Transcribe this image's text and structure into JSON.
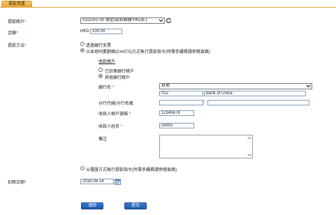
{
  "tabs": {
    "active": "提款資產"
  },
  "form": {
    "account_label": "提款賬戶",
    "account_value": "0111051-00 現金(款款銀額:HKD$-)",
    "amount_label": "金額",
    "amount_currency": "HKD",
    "amount_value": "100.00",
    "method_label": "提款方法",
    "method_options": [
      "透過銀行支票",
      "以本地同業劃帳(CHATS)方式執行提款指令(所需手續費請參閱頁面)",
      "以電匯方式執行提款指令(所需手續費請參閱頁面)"
    ],
    "payee_section_title": "收款帳戶",
    "payee_options": [
      "已註冊銀行賬戶",
      "其他銀行賬戶"
    ],
    "bank_name_label": "銀行名",
    "bank_select_value": "其他",
    "bank_code_value": "012",
    "bank_name_value": "Bank of China",
    "branch_label": "分行代碼/分行名稱",
    "branch_code_value": "",
    "branch_name_value": "",
    "acct_no_label": "收款人帳戶號碼",
    "acct_no_value": "12345678",
    "payee_name_label": "收款人姓名",
    "payee_name_value": "Demo",
    "remarks_label": "備注",
    "remarks_value": "",
    "date_label": "扣賬日期",
    "date_value": "2018-06-14"
  },
  "buttons": {
    "clear": "清除",
    "submit": "提交"
  },
  "colors": {
    "accent": "#e9a43a",
    "button": "#1d57a8",
    "required": "#d01010"
  },
  "icons": {
    "refresh": "refresh-icon",
    "calendar": "calendar-icon",
    "dropdown": "chevron-down-icon"
  }
}
